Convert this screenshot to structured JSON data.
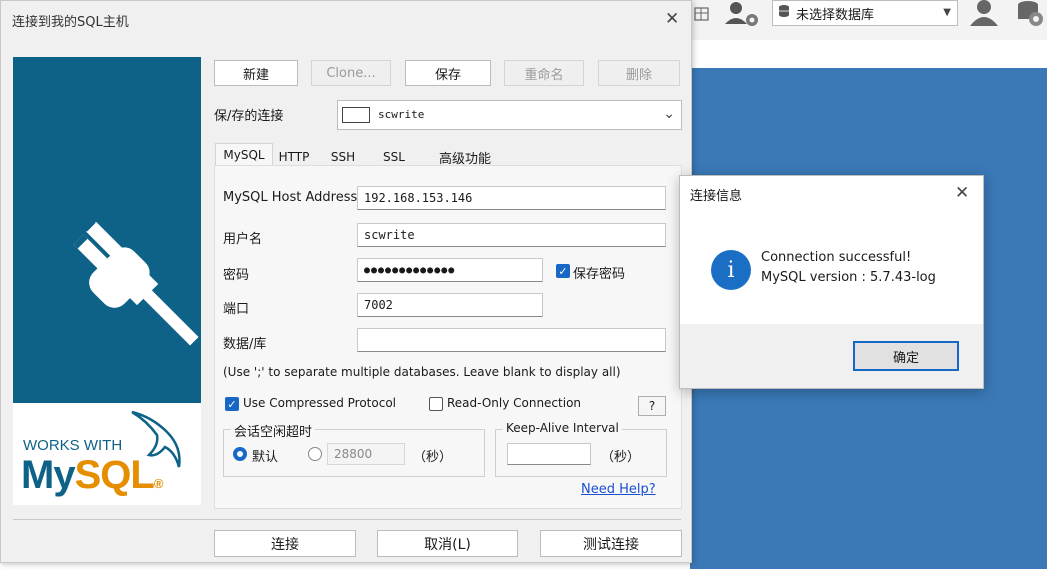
{
  "background_app": {
    "db_select": "未选择数据库"
  },
  "main_dialog": {
    "title": "连接到我的SQL主机",
    "toolbar": {
      "new": "新建",
      "clone": "Clone...",
      "save": "保存",
      "rename": "重命名",
      "delete": "删除"
    },
    "saved_connection_label": "保/存的连接",
    "saved_connection_value": "scwrite",
    "tabs": [
      "MySQL",
      "HTTP",
      "SSH",
      "SSL",
      "高级功能"
    ],
    "form": {
      "host_label": "MySQL Host Address",
      "host_value": "192.168.153.146",
      "user_label": "用户名",
      "user_value": "scwrite",
      "password_label": "密码",
      "password_value": "●●●●●●●●●●●●●",
      "save_password": "保存密码",
      "port_label": "端口",
      "port_value": "7002",
      "database_label": "数据/库",
      "database_value": "",
      "hint": "(Use ';' to separate multiple databases. Leave blank to display all)",
      "compressed": "Use Compressed Protocol",
      "readonly": "Read-Only Connection",
      "help_btn": "?",
      "session_timeout_label": "会话空闲超时",
      "default_radio": "默认",
      "timeout_value": "28800",
      "seconds": "（秒）",
      "keepalive_label": "Keep-Alive Interval",
      "keepalive_value": "",
      "seconds2": "（秒）",
      "need_help": "Need Help?"
    },
    "logo": {
      "works_with": "WORKS WITH",
      "mysql": "MySQL"
    },
    "footer": {
      "connect": "连接",
      "cancel": "取消(L)",
      "test": "测试连接"
    }
  },
  "info_dialog": {
    "title": "连接信息",
    "line1": "Connection successful!",
    "line2": "MySQL version : 5.7.43-log",
    "ok": "确定"
  }
}
